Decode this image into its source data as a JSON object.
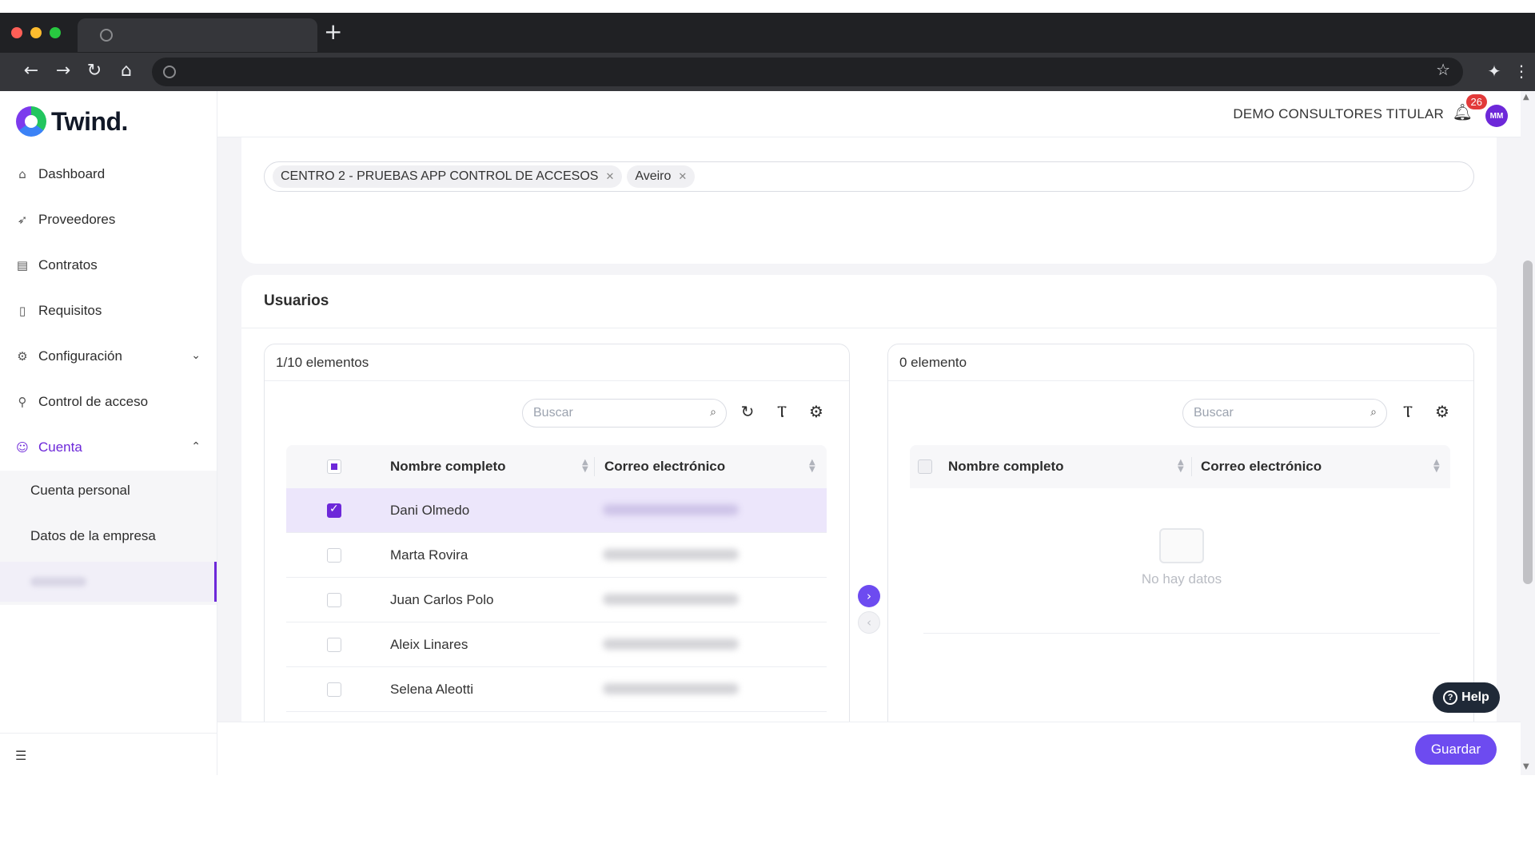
{
  "browser": {
    "new_tab": "+"
  },
  "sidebar": {
    "brand": "Twind.",
    "items": [
      {
        "label": "Dashboard",
        "icon": "home-icon"
      },
      {
        "label": "Proveedores",
        "icon": "rocket-icon"
      },
      {
        "label": "Contratos",
        "icon": "contract-icon"
      },
      {
        "label": "Requisitos",
        "icon": "document-icon"
      },
      {
        "label": "Configuración",
        "icon": "gear-icon"
      },
      {
        "label": "Control de acceso",
        "icon": "key-icon"
      },
      {
        "label": "Cuenta",
        "icon": "user-circle-icon"
      }
    ],
    "sub_items": [
      {
        "label": "Cuenta personal"
      },
      {
        "label": "Datos de la empresa"
      }
    ]
  },
  "header": {
    "account_name": "DEMO CONSULTORES TITULAR",
    "notification_count": "26",
    "avatar_initials": "MM"
  },
  "filters": {
    "tags": [
      {
        "label": "CENTRO 2 - PRUEBAS APP CONTROL DE ACCESOS"
      },
      {
        "label": "Aveiro"
      }
    ]
  },
  "users": {
    "title": "Usuarios",
    "left": {
      "count_label": "1/10 elementos",
      "search_placeholder": "Buscar",
      "columns": [
        "Nombre completo",
        "Correo electrónico"
      ],
      "rows": [
        {
          "name": "Dani Olmedo",
          "checked": true
        },
        {
          "name": "Marta Rovira",
          "checked": false
        },
        {
          "name": "Juan Carlos Polo",
          "checked": false
        },
        {
          "name": "Aleix Linares",
          "checked": false
        },
        {
          "name": "Selena Aleotti",
          "checked": false
        }
      ]
    },
    "right": {
      "count_label": "0 elemento",
      "search_placeholder": "Buscar",
      "columns": [
        "Nombre completo",
        "Correo electrónico"
      ],
      "empty_text": "No hay datos"
    }
  },
  "footer": {
    "save_label": "Guardar"
  },
  "help": {
    "label": "Help"
  },
  "colors": {
    "accent": "#6d4bf0",
    "brand_purple": "#6d28d9",
    "badge_red": "#e23a3a"
  }
}
